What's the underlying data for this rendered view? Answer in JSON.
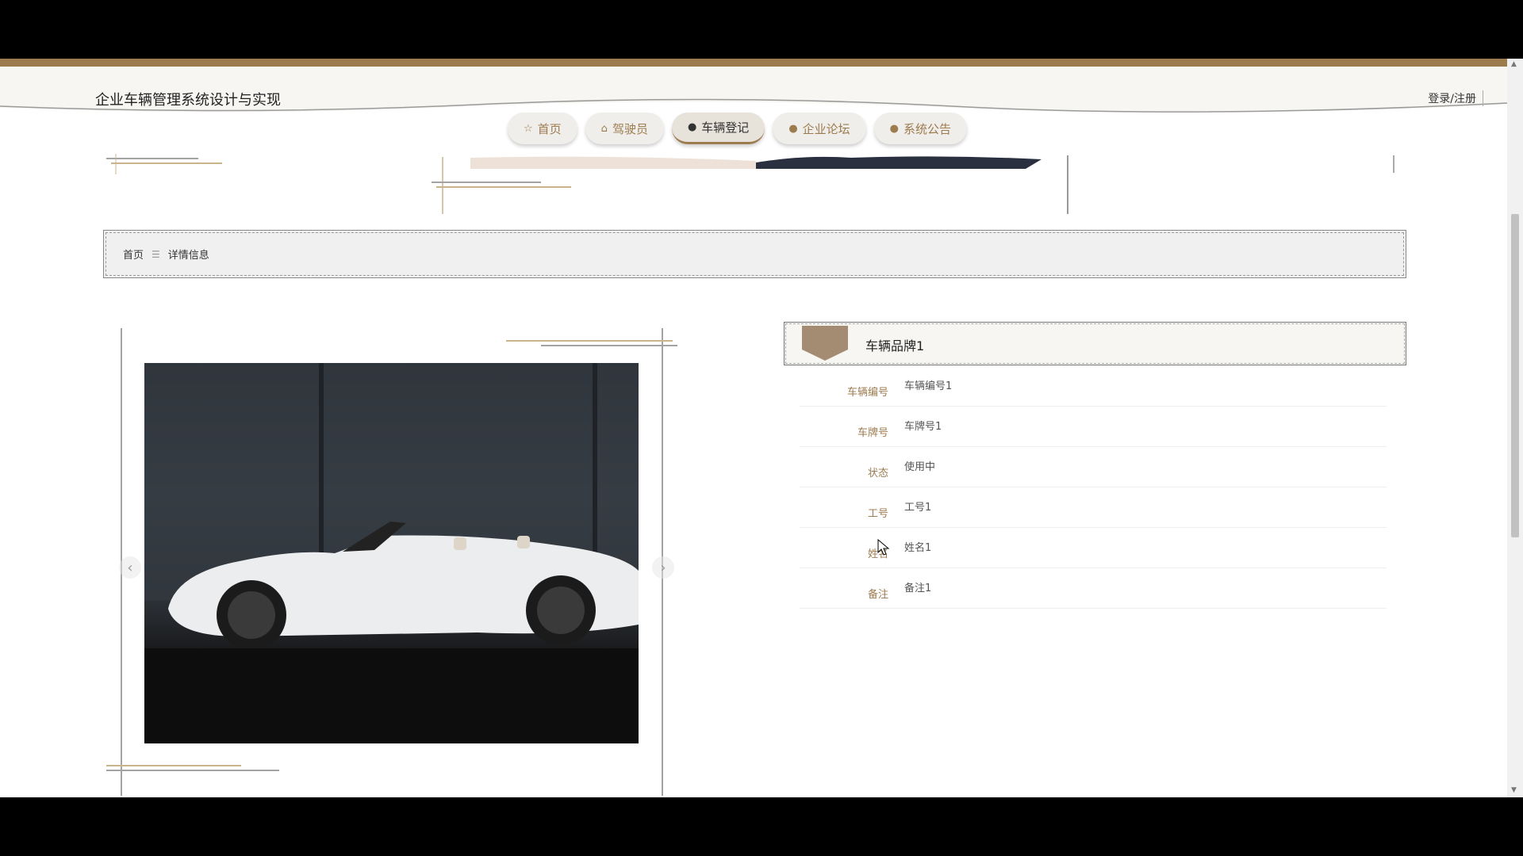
{
  "header": {
    "site_title": "企业车辆管理系统设计与实现",
    "login_label": "登录/注册"
  },
  "nav": {
    "items": [
      {
        "label": "首页",
        "icon": "star-icon"
      },
      {
        "label": "驾驶员",
        "icon": "bag-icon"
      },
      {
        "label": "车辆登记",
        "icon": "exclamation-icon"
      },
      {
        "label": "企业论坛",
        "icon": "question-icon"
      },
      {
        "label": "系统公告",
        "icon": "info-icon"
      }
    ],
    "active": "车辆登记"
  },
  "breadcrumb": {
    "home": "首页",
    "separator": "☰",
    "current": "详情信息"
  },
  "detail": {
    "title": "车辆品牌1",
    "fields": [
      {
        "label": "车辆编号",
        "value": "车辆编号1"
      },
      {
        "label": "车牌号",
        "value": "车牌号1"
      },
      {
        "label": "状态",
        "value": "使用中"
      },
      {
        "label": "工号",
        "value": "工号1"
      },
      {
        "label": "姓名",
        "value": "姓名1"
      },
      {
        "label": "备注",
        "value": "备注1"
      }
    ]
  },
  "colors": {
    "accent": "#9c7b4f",
    "header_bg": "#f7f6f3",
    "breadcrumb_bg": "#f0f0f0"
  }
}
